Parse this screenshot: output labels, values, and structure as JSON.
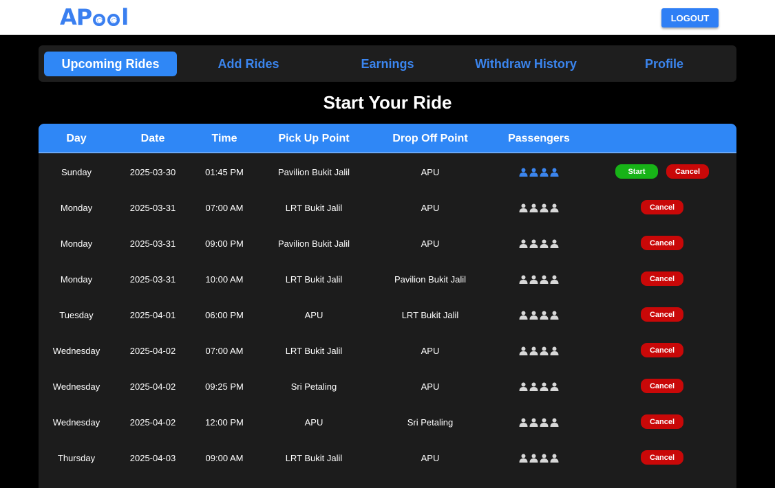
{
  "header": {
    "logo_text": "APool",
    "logo_parts": {
      "a": "A",
      "p": "P",
      "l": "l"
    },
    "logout_label": "LOGOUT"
  },
  "nav": {
    "tabs": [
      {
        "label": "Upcoming Rides",
        "active": true
      },
      {
        "label": "Add Rides",
        "active": false
      },
      {
        "label": "Earnings",
        "active": false
      },
      {
        "label": "Withdraw History",
        "active": false
      },
      {
        "label": "Profile",
        "active": false
      }
    ]
  },
  "page_title": "Start Your Ride",
  "table": {
    "columns": [
      "Day",
      "Date",
      "Time",
      "Pick Up Point",
      "Drop Off Point",
      "Passengers",
      ""
    ],
    "start_label": "Start",
    "cancel_label": "Cancel",
    "rows": [
      {
        "day": "Sunday",
        "date": "2025-03-30",
        "time": "01:45 PM",
        "pickup": "Pavilion Bukit Jalil",
        "dropoff": "APU",
        "passengers_booked": 4,
        "seats": 4,
        "can_start": true
      },
      {
        "day": "Monday",
        "date": "2025-03-31",
        "time": "07:00 AM",
        "pickup": "LRT Bukit Jalil",
        "dropoff": "APU",
        "passengers_booked": 0,
        "seats": 4,
        "can_start": false
      },
      {
        "day": "Monday",
        "date": "2025-03-31",
        "time": "09:00 PM",
        "pickup": "Pavilion Bukit Jalil",
        "dropoff": "APU",
        "passengers_booked": 0,
        "seats": 4,
        "can_start": false
      },
      {
        "day": "Monday",
        "date": "2025-03-31",
        "time": "10:00 AM",
        "pickup": "LRT Bukit Jalil",
        "dropoff": "Pavilion Bukit Jalil",
        "passengers_booked": 0,
        "seats": 4,
        "can_start": false
      },
      {
        "day": "Tuesday",
        "date": "2025-04-01",
        "time": "06:00 PM",
        "pickup": "APU",
        "dropoff": "LRT Bukit Jalil",
        "passengers_booked": 0,
        "seats": 4,
        "can_start": false
      },
      {
        "day": "Wednesday",
        "date": "2025-04-02",
        "time": "07:00 AM",
        "pickup": "LRT Bukit Jalil",
        "dropoff": "APU",
        "passengers_booked": 0,
        "seats": 4,
        "can_start": false
      },
      {
        "day": "Wednesday",
        "date": "2025-04-02",
        "time": "09:25 PM",
        "pickup": "Sri Petaling",
        "dropoff": "APU",
        "passengers_booked": 0,
        "seats": 4,
        "can_start": false
      },
      {
        "day": "Wednesday",
        "date": "2025-04-02",
        "time": "12:00 PM",
        "pickup": "APU",
        "dropoff": "Sri Petaling",
        "passengers_booked": 0,
        "seats": 4,
        "can_start": false
      },
      {
        "day": "Thursday",
        "date": "2025-04-03",
        "time": "09:00 AM",
        "pickup": "LRT Bukit Jalil",
        "dropoff": "APU",
        "passengers_booked": 0,
        "seats": 4,
        "can_start": false
      }
    ]
  },
  "colors": {
    "accent": "#2f87f6",
    "passenger_booked": "#3b85ee",
    "passenger_empty": "#d8d8d8",
    "start": "#17b317",
    "cancel": "#c90808"
  },
  "icons": {
    "passenger": "person-icon"
  }
}
